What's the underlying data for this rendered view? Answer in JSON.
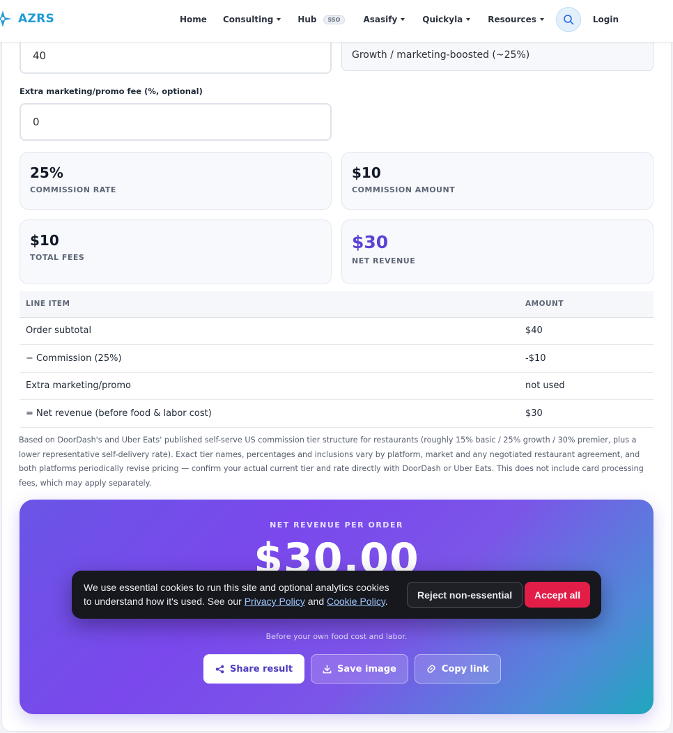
{
  "navbar": {
    "brand": "AZRS",
    "items": [
      {
        "label": "Home",
        "dropdown": false
      },
      {
        "label": "Consulting",
        "dropdown": true
      },
      {
        "label": "Hub",
        "dropdown": false,
        "badge": "SSO"
      },
      {
        "label": "Asasify",
        "dropdown": true
      },
      {
        "label": "Quickyla",
        "dropdown": true
      },
      {
        "label": "Resources",
        "dropdown": true
      }
    ],
    "search_icon": "search-icon",
    "login": "Login"
  },
  "form": {
    "order_value": "40",
    "tier_selected": "Growth / marketing-boosted (~25%)",
    "promo_label": "Extra marketing/promo fee (%, optional)",
    "promo_value": "0"
  },
  "stats": {
    "commission_rate": {
      "value": "25%",
      "label": "COMMISSION RATE"
    },
    "commission_amount": {
      "value": "$10",
      "label": "COMMISSION AMOUNT"
    },
    "total_fees": {
      "value": "$10",
      "label": "TOTAL FEES"
    },
    "net_revenue": {
      "value": "$30",
      "label": "NET REVENUE"
    }
  },
  "table": {
    "headers": [
      "LINE ITEM",
      "AMOUNT"
    ],
    "rows": [
      {
        "item": "Order subtotal",
        "amount": "$40"
      },
      {
        "item": "− Commission (25%)",
        "amount": "-$10"
      },
      {
        "item": "Extra marketing/promo",
        "amount": "not used"
      },
      {
        "item": "= Net revenue (before food & labor cost)",
        "amount": "$30"
      }
    ]
  },
  "disclaimer": "Based on DoorDash's and Uber Eats' published self-serve US commission tier structure for restaurants (roughly 15% basic / 25% growth / 30% premier, plus a lower representative self-delivery rate). Exact tier names, percentages and inclusions vary by platform, market and any negotiated restaurant agreement, and both platforms periodically revise pricing — confirm your actual current tier and rate directly with DoorDash or Uber Eats. This does not include card processing fees, which may apply separately.",
  "hero": {
    "kicker": "NET REVENUE PER ORDER",
    "value": "$30.00",
    "subtext": "Before your own food cost and labor.",
    "buttons": {
      "share": "Share result",
      "save": "Save image",
      "copy": "Copy link"
    }
  },
  "cookie": {
    "text_prefix": "We use essential cookies to run this site and optional analytics cookies to understand how it's used. See our ",
    "privacy_link": "Privacy Policy",
    "and": " and ",
    "cookie_link": "Cookie Policy",
    "suffix": ".",
    "reject": "Reject non-essential",
    "accept": "Accept all"
  },
  "colors": {
    "accent": "#5b43d6",
    "brand": "#1d9bd8",
    "accept": "#e11d48"
  }
}
